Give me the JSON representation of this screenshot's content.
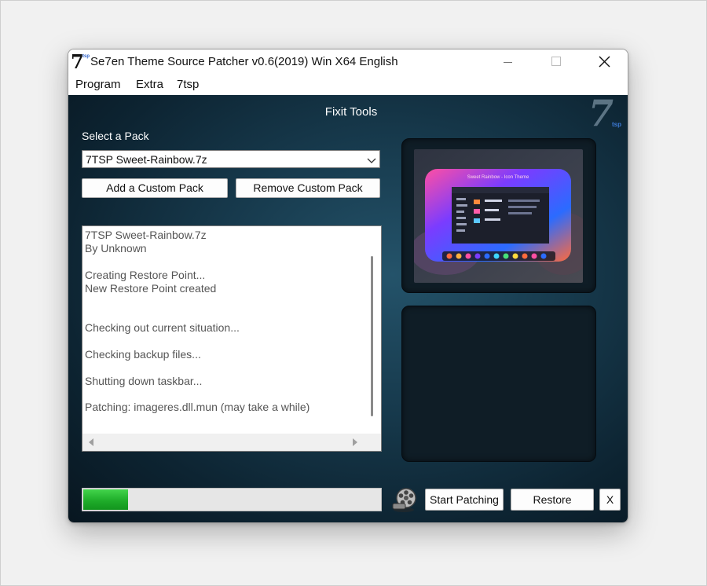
{
  "window": {
    "title": "Se7en Theme Source Patcher v0.6(2019) Win X64 English",
    "logo_main": "7",
    "logo_sub": "tsp"
  },
  "menu": {
    "items": [
      "Program",
      "Extra",
      "7tsp"
    ]
  },
  "main": {
    "heading": "Fixit Tools",
    "corner_logo_main": "7",
    "corner_logo_sub": "tsp",
    "select_label": "Select a Pack",
    "selected_pack": "7TSP Sweet-Rainbow.7z",
    "add_button": "Add a Custom Pack",
    "remove_button": "Remove Custom Pack",
    "log_lines": [
      "7TSP Sweet-Rainbow.7z",
      "By Unknown",
      "",
      "Creating Restore Point...",
      "New Restore Point created",
      "",
      "",
      "Checking out current situation...",
      "",
      "Checking backup files...",
      "",
      "Shutting down taskbar...",
      "",
      "Patching: imageres.dll.mun (may take a while)"
    ],
    "preview_caption": "Sweet Rainbow - Icon Theme",
    "progress_fraction": 0.15
  },
  "footer": {
    "start_button": "Start Patching",
    "restore_button": "Restore",
    "close_button": "X"
  },
  "icons": {
    "close": "close-icon",
    "minimize": "minimize-icon",
    "maximize": "maximize-icon",
    "dropdown": "chevron-down-icon",
    "reel": "film-reel-icon"
  },
  "colors": {
    "progress": "#1fad2a",
    "panel_bg": "#173a4d"
  }
}
